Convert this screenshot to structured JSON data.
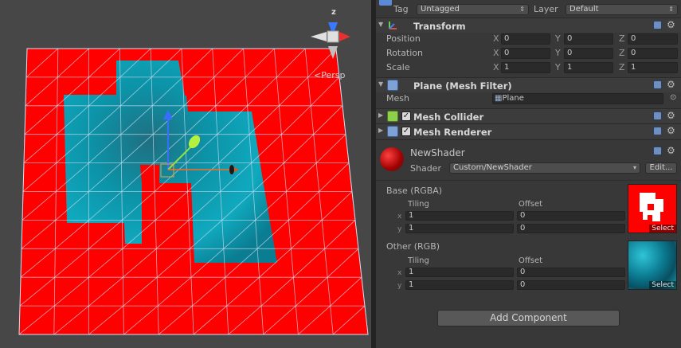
{
  "scene": {
    "projection_label": "Persp",
    "gizmo_axis_label": "z",
    "colors": {
      "background": "#474747",
      "plane_red": "#ff0000",
      "plane_cyan": "#0f8ea3",
      "grid": "#9fbfe0"
    }
  },
  "inspector": {
    "tag_label": "Tag",
    "tag_value": "Untagged",
    "layer_label": "Layer",
    "layer_value": "Default",
    "transform": {
      "title": "Transform",
      "rows": [
        {
          "label": "Position",
          "x": "0",
          "y": "0",
          "z": "0"
        },
        {
          "label": "Rotation",
          "x": "0",
          "y": "0",
          "z": "0"
        },
        {
          "label": "Scale",
          "x": "1",
          "y": "1",
          "z": "1"
        }
      ],
      "axis_x": "X",
      "axis_y": "Y",
      "axis_z": "Z"
    },
    "mesh_filter": {
      "title": "Plane (Mesh Filter)",
      "mesh_label": "Mesh",
      "mesh_value": "Plane"
    },
    "mesh_collider": {
      "title": "Mesh Collider",
      "enabled": true
    },
    "mesh_renderer": {
      "title": "Mesh Renderer",
      "enabled": true
    },
    "material": {
      "name": "NewShader",
      "shader_label": "Shader",
      "shader_value": "Custom/NewShader",
      "edit_label": "Edit...",
      "properties": [
        {
          "name": "Base (RGBA)",
          "tiling_label": "Tiling",
          "offset_label": "Offset",
          "tiling_x": "1",
          "tiling_y": "1",
          "offset_x": "0",
          "offset_y": "0",
          "select_label": "Select",
          "axis_x": "x",
          "axis_y": "y"
        },
        {
          "name": "Other (RGB)",
          "tiling_label": "Tiling",
          "offset_label": "Offset",
          "tiling_x": "1",
          "tiling_y": "1",
          "offset_x": "0",
          "offset_y": "0",
          "select_label": "Select",
          "axis_x": "x",
          "axis_y": "y"
        }
      ]
    },
    "add_component_label": "Add Component"
  }
}
